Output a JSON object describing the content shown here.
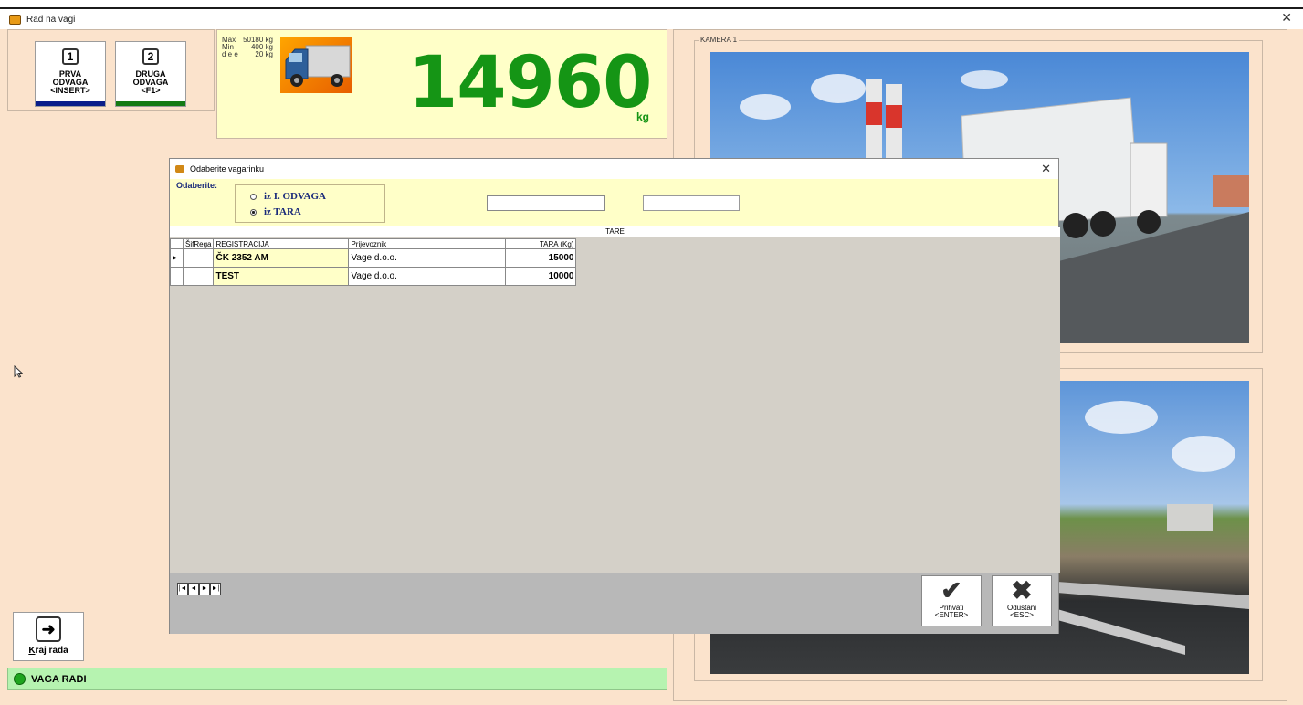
{
  "window": {
    "title": "Rad na vagi"
  },
  "buttons": {
    "first": {
      "num": "1",
      "l1": "PRVA",
      "l2": "ODVAGA",
      "l3": "<INSERT>",
      "color": "#0a1e8a"
    },
    "second": {
      "num": "2",
      "l1": "DRUGA",
      "l2": "ODVAGA",
      "l3": "<F1>",
      "color": "#147a14"
    },
    "exit": {
      "icon": "exit-arrow-icon",
      "label_u": "K",
      "label_rest": "raj rada"
    }
  },
  "scale": {
    "max_label": "Max",
    "max_value": "50180 kg",
    "min_label": "Min",
    "min_value": "400 kg",
    "d_label": "d e e",
    "d_value": "20 kg",
    "weight": "14960",
    "unit": "kg"
  },
  "camera": {
    "label": "KAMERA 1"
  },
  "status": {
    "text": "VAGA RADI",
    "color": "#1ea51e"
  },
  "dialog": {
    "title": "Odaberite vagarinku",
    "select_label": "Odaberite:",
    "radio1": "iz I. ODVAGA",
    "radio2": "iz TARA",
    "selected": "iz TARA",
    "input1": "",
    "input2": "",
    "grid_caption": "TARE",
    "columns": [
      "ŠifRega",
      "REGISTRACIJA",
      "Prijevoznik",
      "TARA (Kg)"
    ],
    "rows": [
      {
        "reg": "ČK 2352 AM",
        "prijevoznik": "Vage d.o.o.",
        "tara": "15000"
      },
      {
        "reg": "TEST",
        "prijevoznik": "Vage d.o.o.",
        "tara": "10000"
      }
    ],
    "nav": [
      "|◄",
      "◄",
      "►",
      "►|"
    ],
    "accept": {
      "l1": "Prihvati",
      "l2": "<ENTER>"
    },
    "cancel": {
      "l1": "Odustani",
      "l2": "<ESC>"
    }
  }
}
